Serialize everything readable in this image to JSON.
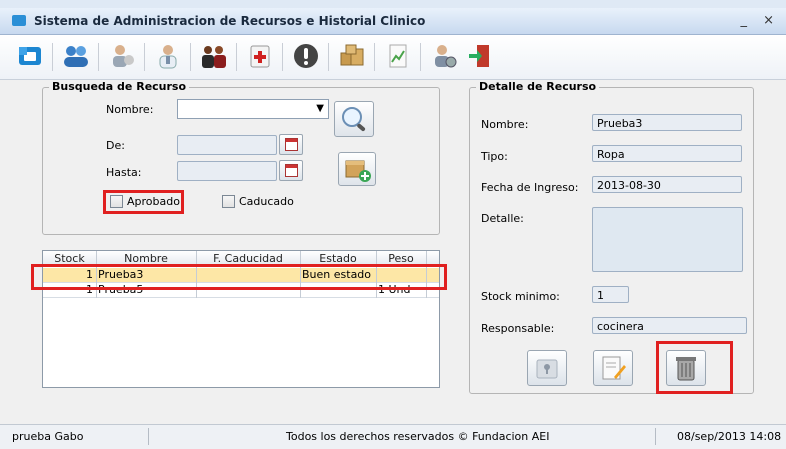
{
  "window": {
    "title": "Sistema de Administracion de Recursos e Historial Clinico",
    "controls": "_ ×"
  },
  "toolbar": {
    "icons": [
      "home-icon",
      "users-group-icon",
      "user-assign-icon",
      "doctor-icon",
      "family-icon",
      "medical-kit-icon",
      "alert-icon",
      "boxes-icon",
      "report-icon",
      "user-settings-icon",
      "exit-door-icon"
    ]
  },
  "search": {
    "legend": "Busqueda de Recurso",
    "nombre_label": "Nombre:",
    "nombre_value": "",
    "de_label": "De:",
    "de_value": "",
    "hasta_label": "Hasta:",
    "hasta_value": "",
    "aprobado_label": "Aprobado",
    "caducado_label": "Caducado"
  },
  "table": {
    "columns": [
      "Stock",
      "Nombre",
      "F. Caducidad",
      "Estado",
      "Peso"
    ],
    "rows": [
      {
        "stock": "1",
        "nombre": "Prueba3",
        "caducidad": "",
        "estado": "Buen estado",
        "peso": ""
      },
      {
        "stock": "1",
        "nombre": "Prueba5",
        "caducidad": "",
        "estado": "",
        "peso": "1 Und"
      }
    ]
  },
  "detail": {
    "legend": "Detalle de Recurso",
    "nombre_label": "Nombre:",
    "nombre_value": "Prueba3",
    "tipo_label": "Tipo:",
    "tipo_value": "Ropa",
    "fecha_label": "Fecha de Ingreso:",
    "fecha_value": "2013-08-30",
    "detalle_label": "Detalle:",
    "detalle_value": "",
    "stock_label": "Stock minimo:",
    "stock_value": "1",
    "responsable_label": "Responsable:",
    "responsable_value": "cocinera"
  },
  "status": {
    "user": "prueba Gabo",
    "copyright": "Todos los derechos reservados © Fundacion AEI",
    "datetime": "08/sep/2013 14:08"
  },
  "colors": {
    "highlight_red": "#e02020",
    "selected_row": "#fde7a6"
  }
}
